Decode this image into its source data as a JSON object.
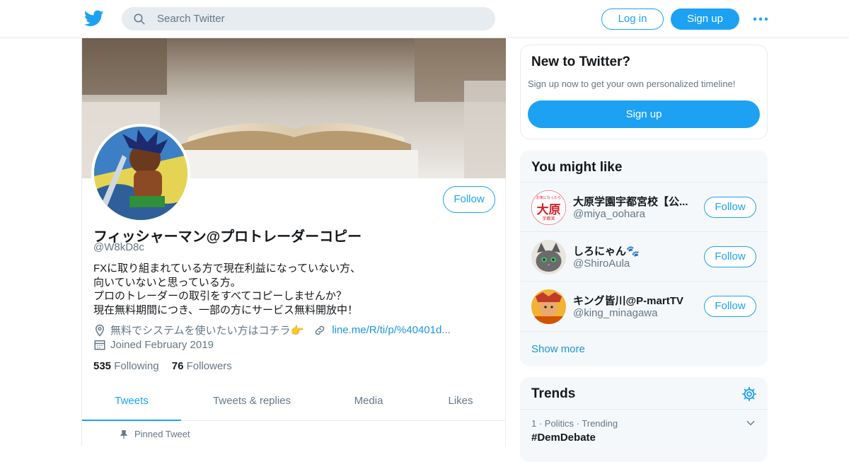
{
  "header": {
    "search_placeholder": "Search Twitter",
    "login_label": "Log in",
    "signup_label": "Sign up"
  },
  "profile": {
    "name": "フィッシャーマン@プロトレーダーコピー",
    "handle": "@W8kD8c",
    "follow_label": "Follow",
    "bio_lines": [
      "FXに取り組まれている方で現在利益になっていない方、",
      "向いていないと思っている方。",
      "プロのトレーダーの取引をすべてコピーしませんか？",
      "現在無料期間につき、一部の方にサービス無料開放中！"
    ],
    "location": "無料でシステムを使いたい方はコチラ👉",
    "link": "line.me/R/ti/p/%40401d...",
    "joined": "Joined February 2019",
    "following_count": "535",
    "following_label": "Following",
    "followers_count": "76",
    "followers_label": "Followers"
  },
  "tabs": [
    {
      "label": "Tweets",
      "active": true
    },
    {
      "label": "Tweets & replies",
      "active": false
    },
    {
      "label": "Media",
      "active": false
    },
    {
      "label": "Likes",
      "active": false
    }
  ],
  "pinned_label": "Pinned Tweet",
  "new_to_twitter": {
    "title": "New to Twitter?",
    "subtitle": "Sign up now to get your own personalized timeline!",
    "button": "Sign up"
  },
  "you_might_like": {
    "title": "You might like",
    "accounts": [
      {
        "name": "大原学園宇都宮校【公...",
        "handle": "@miya_oohara",
        "button": "Follow",
        "avatar_text": "大原",
        "avatar_top": "お気になったら",
        "avatar_bottom": "宇都宮"
      },
      {
        "name": "しろにゃん🐾",
        "handle": "@ShiroAula",
        "button": "Follow"
      },
      {
        "name": "キング皆川@P-martTV",
        "handle": "@king_minagawa",
        "button": "Follow"
      }
    ],
    "show_more": "Show more"
  },
  "trends": {
    "title": "Trends",
    "items": [
      {
        "category": "1 · Politics · Trending",
        "name": "#DemDebate"
      }
    ]
  },
  "colors": {
    "accent": "#1da1f2",
    "secondary_text": "#657786",
    "link": "#1b95e0",
    "panel_bg": "#f5f8fa"
  }
}
